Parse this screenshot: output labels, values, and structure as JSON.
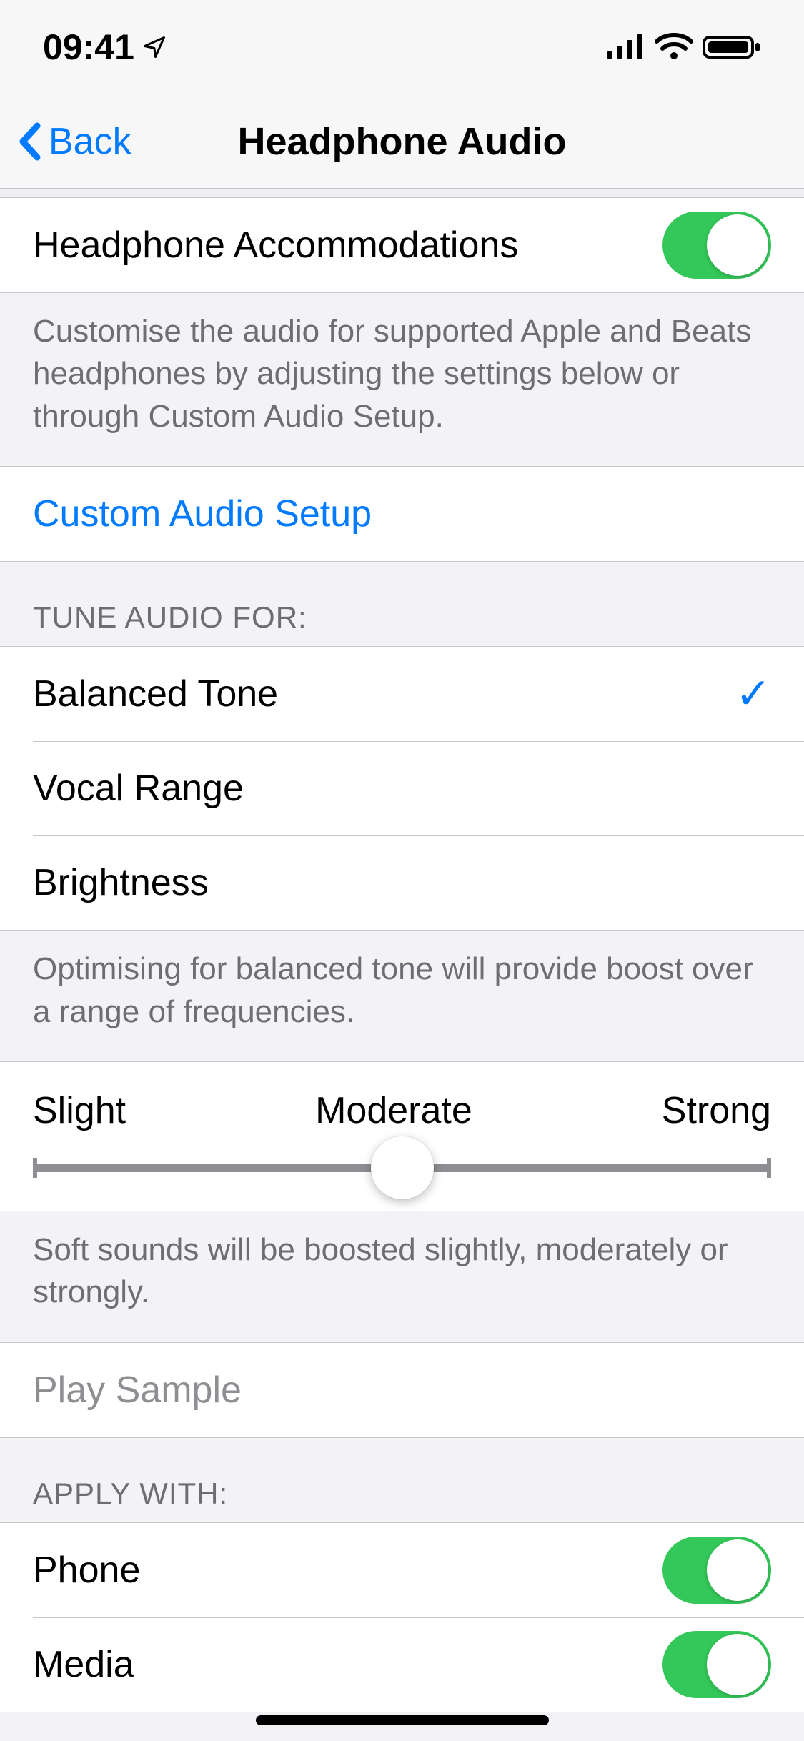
{
  "statusBar": {
    "time": "09:41"
  },
  "nav": {
    "back": "Back",
    "title": "Headphone Audio"
  },
  "accommodations": {
    "label": "Headphone Accommodations",
    "on": true,
    "footer": "Customise the audio for supported Apple and Beats headphones by adjusting the settings below or through Custom Audio Setup."
  },
  "customSetup": {
    "label": "Custom Audio Setup"
  },
  "tune": {
    "header": "TUNE AUDIO FOR:",
    "options": [
      {
        "label": "Balanced Tone",
        "selected": true
      },
      {
        "label": "Vocal Range",
        "selected": false
      },
      {
        "label": "Brightness",
        "selected": false
      }
    ],
    "footer": "Optimising for balanced tone will provide boost over a range of frequencies."
  },
  "slider": {
    "labels": {
      "left": "Slight",
      "mid": "Moderate",
      "right": "Strong"
    },
    "value": 1,
    "footer": "Soft sounds will be boosted slightly, moderately or strongly."
  },
  "playSample": {
    "label": "Play Sample"
  },
  "applyWith": {
    "header": "APPLY WITH:",
    "items": [
      {
        "label": "Phone",
        "on": true
      },
      {
        "label": "Media",
        "on": true
      }
    ]
  }
}
